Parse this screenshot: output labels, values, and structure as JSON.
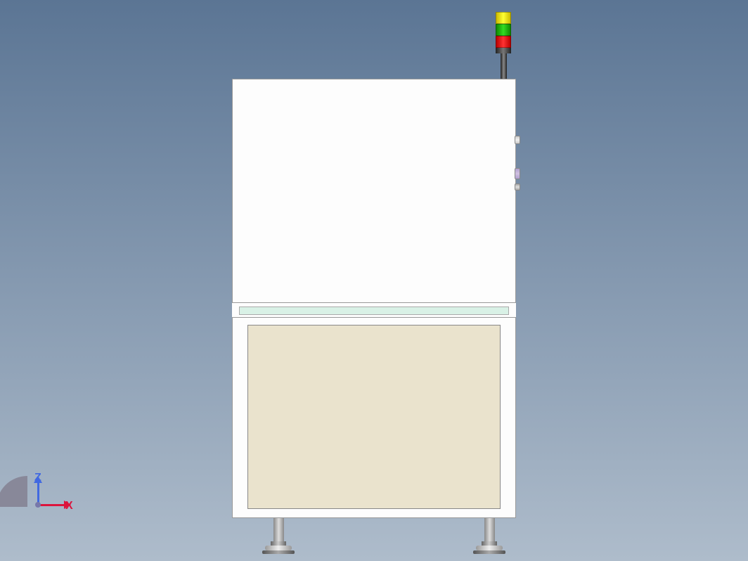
{
  "axes": {
    "vertical_label": "Z",
    "horizontal_label": "X"
  },
  "signal_tower": {
    "lights": [
      "yellow",
      "green",
      "red"
    ]
  },
  "colors": {
    "upper_cabinet": "#fdfdfd",
    "lower_panel": "#eae3cd",
    "green_strip": "#d9f1e6",
    "light_yellow": "#ffff33",
    "light_green": "#33dd22",
    "light_red": "#ff3333",
    "axis_z": "#4169e1",
    "axis_x": "#dc143c"
  }
}
